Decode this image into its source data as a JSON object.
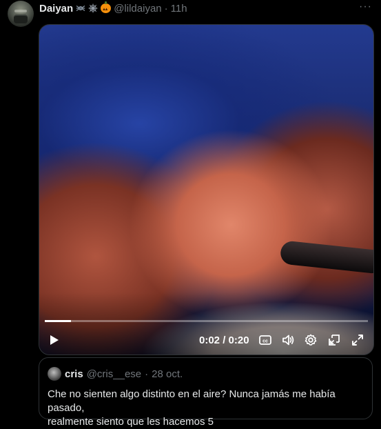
{
  "tweet": {
    "author_name": "Daiyan",
    "author_emojis": [
      "spider-icon",
      "spider-web-icon",
      "jack-o-lantern-icon"
    ],
    "handle": "@lildaiyan",
    "separator": "·",
    "time": "11h",
    "more_label": "···"
  },
  "video": {
    "progress_fraction": 0.08,
    "time_display": "0:02 / 0:20",
    "controls": [
      "play-icon",
      "captions-icon",
      "volume-icon",
      "settings-icon",
      "picture-in-picture-icon",
      "fullscreen-icon"
    ]
  },
  "quoted_tweet": {
    "author_name": "cris",
    "handle": "@cris__ese",
    "separator": "·",
    "date": "28 oct.",
    "text_line1": "Che no sienten algo distinto en el aire? Nunca jamás me había pasado,",
    "text_line2": "realmente siento que les hacemos 5"
  },
  "colors": {
    "background": "#000000",
    "text_primary": "#e7e9ea",
    "text_secondary": "#71767b",
    "border": "#2f3336"
  }
}
